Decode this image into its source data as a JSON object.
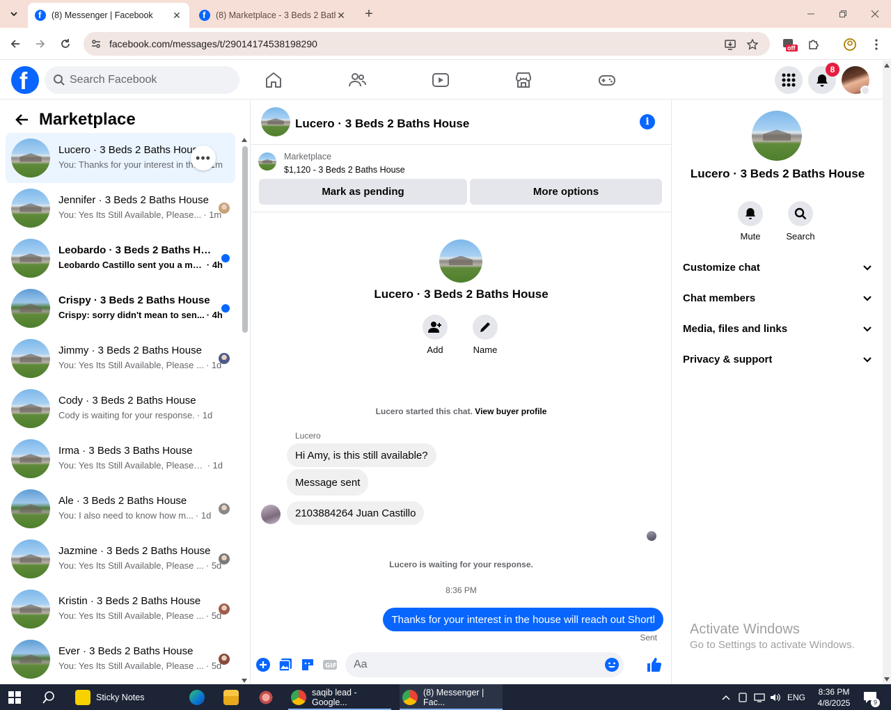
{
  "browser": {
    "tabs": [
      {
        "title": "(8) Messenger | Facebook",
        "active": true
      },
      {
        "title": "(8) Marketplace - 3 Beds 2 Bath",
        "active": false
      }
    ],
    "url": "facebook.com/messages/t/29014174538198290",
    "extension_badge": "off"
  },
  "fb": {
    "search_placeholder": "Search Facebook",
    "notification_count": "8"
  },
  "left": {
    "title": "Marketplace",
    "conversations": [
      {
        "name": "Lucero · 3 Beds 2 Baths House",
        "snippet": "You: Thanks for your interest in the house will reach out Shortly",
        "time": "· 1m",
        "selected": true,
        "unread": false,
        "indicator": "more"
      },
      {
        "name": "Jennifer · 3 Beds 2 Baths House",
        "snippet": "You: Yes Its Still Available, Please...",
        "time": "· 1m",
        "selected": false,
        "unread": false,
        "indicator": "avatar"
      },
      {
        "name": "Leobardo · 3 Beds 2 Baths House",
        "snippet": "Leobardo Castillo sent you a me...",
        "time": "· 4h",
        "selected": false,
        "unread": true,
        "indicator": "dot"
      },
      {
        "name": "Crispy · 3 Beds 2 Baths House",
        "snippet": "Crispy: sorry didn't mean to sen...",
        "time": "· 4h",
        "selected": false,
        "unread": true,
        "indicator": "dot"
      },
      {
        "name": "Jimmy · 3 Beds 2 Baths House",
        "snippet": "You: Yes Its Still Available, Please ...",
        "time": "· 1d",
        "selected": false,
        "unread": false,
        "indicator": "avatar"
      },
      {
        "name": "Cody · 3 Beds 2 Baths House",
        "snippet": "Cody is waiting for your response.",
        "time": "· 1d",
        "selected": false,
        "unread": false,
        "indicator": "none"
      },
      {
        "name": "Irma · 3 Beds 3 Baths House",
        "snippet": "You: Yes Its Still Available, Please Se...",
        "time": "· 1d",
        "selected": false,
        "unread": false,
        "indicator": "none"
      },
      {
        "name": "Ale · 3 Beds 2 Baths House",
        "snippet": "You: I also need to know how m...",
        "time": "· 1d",
        "selected": false,
        "unread": false,
        "indicator": "avatar"
      },
      {
        "name": "Jazmine · 3 Beds 2 Baths House",
        "snippet": "You: Yes Its Still Available, Please ...",
        "time": "· 5d",
        "selected": false,
        "unread": false,
        "indicator": "avatar"
      },
      {
        "name": "Kristin · 3 Beds 2 Baths House",
        "snippet": "You: Yes Its Still Available, Please ...",
        "time": "· 5d",
        "selected": false,
        "unread": false,
        "indicator": "avatar"
      },
      {
        "name": "Ever · 3 Beds 2 Baths House",
        "snippet": "You: Yes Its Still Available, Please ...",
        "time": "· 5d",
        "selected": false,
        "unread": false,
        "indicator": "avatar"
      }
    ]
  },
  "chat": {
    "title": "Lucero · 3 Beds 2 Baths House",
    "marketplace_label": "Marketplace",
    "listing": "$1,120 - 3 Beds 2 Baths House",
    "btn_pending": "Mark as pending",
    "btn_more": "More options",
    "intro_name": "Lucero · 3 Beds 2 Baths House",
    "action_add": "Add",
    "action_name": "Name",
    "started": "Lucero started this chat.",
    "buyer_link": "View buyer profile",
    "sender": "Lucero",
    "messages_in": [
      "Hi Amy, is this still available?",
      "Message sent",
      "2103884264 Juan Castillo"
    ],
    "waiting": "Lucero is waiting for your response.",
    "timestamp": "8:36 PM",
    "message_out": "Thanks for your interest in the house will reach out Shortl",
    "sent": "Sent",
    "composer_placeholder": "Aa"
  },
  "info": {
    "name": "Lucero · 3 Beds 2 Baths House",
    "mute": "Mute",
    "search": "Search",
    "sections": [
      "Customize chat",
      "Chat members",
      "Media, files and links",
      "Privacy & support"
    ]
  },
  "watermark": {
    "line1": "Activate Windows",
    "line2": "Go to Settings to activate Windows."
  },
  "taskbar": {
    "sticky": "Sticky Notes",
    "chrome1": "saqib lead - Google...",
    "chrome2": "(8) Messenger | Fac...",
    "lang": "ENG",
    "time": "8:36 PM",
    "date": "4/8/2025",
    "notif": "9"
  },
  "colors": {
    "accent": "#0866ff",
    "badge": "#e41e3f",
    "tabbar": "#f6dfd6"
  }
}
